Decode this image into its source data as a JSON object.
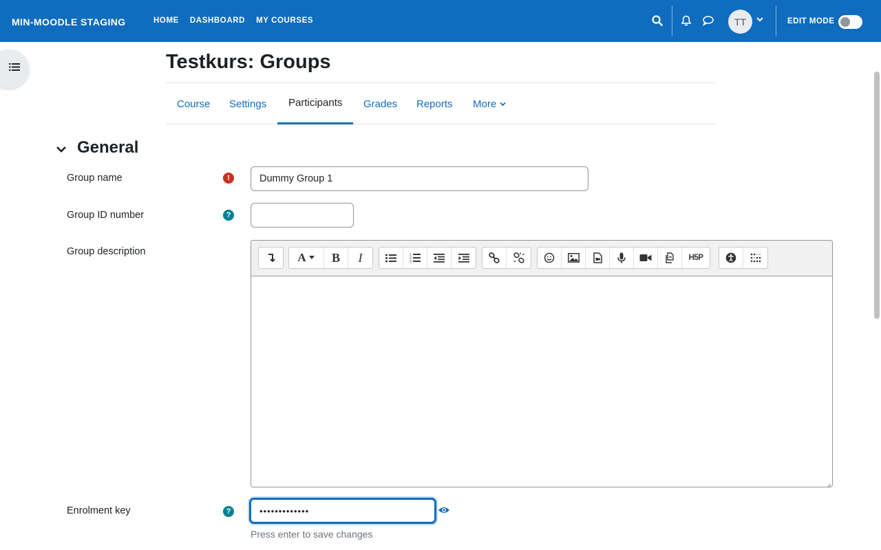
{
  "navbar": {
    "brand": "MIN-MOODLE STAGING",
    "links": [
      "HOME",
      "DASHBOARD",
      "MY COURSES"
    ],
    "avatar_initials": "TT",
    "edit_mode_label": "EDIT MODE",
    "edit_mode_on": false
  },
  "page": {
    "title": "Testkurs: Groups",
    "tabs": [
      {
        "label": "Course",
        "active": false
      },
      {
        "label": "Settings",
        "active": false
      },
      {
        "label": "Participants",
        "active": true
      },
      {
        "label": "Grades",
        "active": false
      },
      {
        "label": "Reports",
        "active": false
      },
      {
        "label": "More",
        "active": false
      }
    ]
  },
  "form": {
    "section_title": "General",
    "group_name": {
      "label": "Group name",
      "value": "Dummy Group 1"
    },
    "group_id": {
      "label": "Group ID number",
      "value": ""
    },
    "group_description": {
      "label": "Group description",
      "value": ""
    },
    "enrolment_key": {
      "label": "Enrolment key",
      "value": "•••••••••••••",
      "hint": "Press enter to save changes"
    }
  },
  "editor_toolbar": [
    [
      "collapse-icon"
    ],
    [
      "font-color-icon",
      "bold-icon",
      "italic-icon"
    ],
    [
      "unordered-list-icon",
      "ordered-list-icon",
      "outdent-icon",
      "indent-icon"
    ],
    [
      "link-icon",
      "unlink-icon"
    ],
    [
      "emoji-icon",
      "image-icon",
      "media-file-icon",
      "record-audio-icon",
      "record-video-icon",
      "manage-files-icon",
      "h5p-icon"
    ],
    [
      "accessibility-checker-icon",
      "screenreader-helper-icon"
    ]
  ],
  "colors": {
    "brand": "#0f6cbf",
    "help": "#008196",
    "required": "#ca3120",
    "focus": "#0f6cbf"
  }
}
